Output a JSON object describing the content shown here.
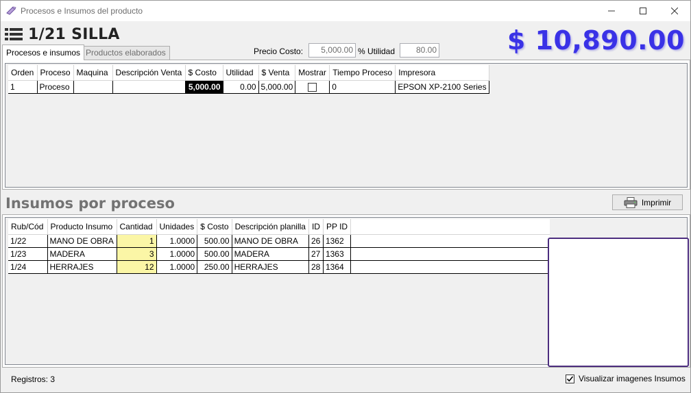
{
  "window": {
    "title": "Procesos e Insumos del producto"
  },
  "header": {
    "product_title": "1/21 SILLA",
    "big_price": "$ 10,890.00"
  },
  "tabs": [
    {
      "label": "Procesos e insumos",
      "active": true
    },
    {
      "label": "Productos elaborados",
      "active": false
    }
  ],
  "pricing": {
    "precio_costo_label": "Precio Costo:",
    "precio_costo_value": "5,000.00",
    "utilidad_label": "% Utilidad",
    "utilidad_value": "80.00"
  },
  "procesos": {
    "columns": [
      "Orden",
      "Proceso",
      "Maquina",
      "Descripción Venta",
      "$ Costo",
      "Utilidad",
      "$ Venta",
      "Mostrar",
      "Tiempo Proceso",
      "Impresora"
    ],
    "rows": [
      {
        "orden": "1",
        "proceso": "Proceso",
        "maquina": "",
        "descripcion": "",
        "costo": "5,000.00",
        "utilidad": "0.00",
        "venta": "5,000.00",
        "mostrar": false,
        "tiempo": "0",
        "impresora": "EPSON XP-2100 Series"
      }
    ]
  },
  "insumos": {
    "section_title": "Insumos por proceso",
    "print_label": "Imprimir",
    "columns": [
      "Rub/Cód",
      "Producto Insumo",
      "Cantidad",
      "Unidades",
      "$ Costo",
      "Descripción planilla",
      "ID",
      "PP ID"
    ],
    "rows": [
      {
        "rub": "1/22",
        "producto": "MANO DE OBRA",
        "cantidad": "1",
        "unidades": "1.0000",
        "costo": "500.00",
        "descripcion": "MANO DE OBRA",
        "id": "26",
        "ppid": "1362"
      },
      {
        "rub": "1/23",
        "producto": "MADERA",
        "cantidad": "3",
        "unidades": "1.0000",
        "costo": "500.00",
        "descripcion": "MADERA",
        "id": "27",
        "ppid": "1363"
      },
      {
        "rub": "1/24",
        "producto": "HERRAJES",
        "cantidad": "12",
        "unidades": "1.0000",
        "costo": "250.00",
        "descripcion": "HERRAJES",
        "id": "28",
        "ppid": "1364"
      }
    ]
  },
  "status": {
    "registros": "Registros: 3",
    "visualizar_label": "Visualizar imagenes Insumos",
    "visualizar_checked": true
  },
  "colors": {
    "accent_price": "#3a32e6",
    "selected_cell": "#000000",
    "cantidad_highlight": "#fbf6a6",
    "image_border": "#4b2c7e"
  },
  "icons": [
    "app-icon",
    "minimize-icon",
    "maximize-icon",
    "close-icon",
    "list-icon",
    "printer-icon",
    "checkmark-icon"
  ]
}
